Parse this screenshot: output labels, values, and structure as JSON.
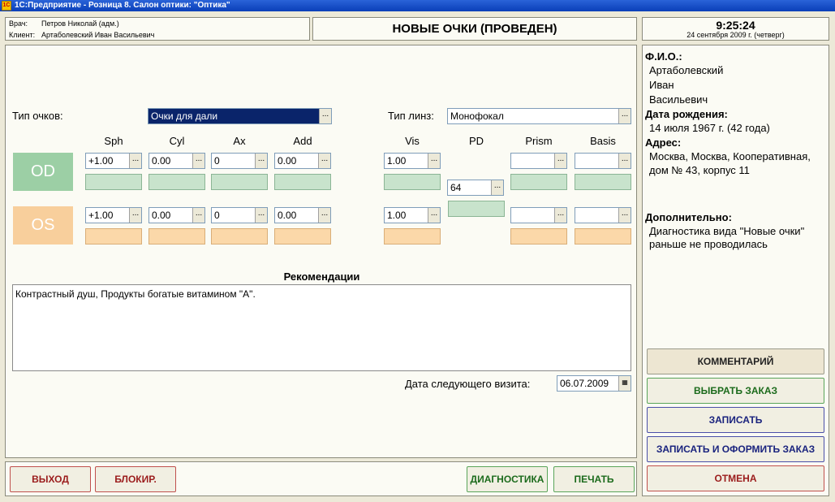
{
  "window": {
    "title": "1С:Предприятие - Розница 8. Салон оптики: \"Оптика\"",
    "icon_text": "1C"
  },
  "header": {
    "doctor_label": "Врач:",
    "doctor_value": "Петров Николай (адм.)",
    "client_label": "Клиент:",
    "client_value": "Артаболевский Иван Васильевич",
    "doc_title": "НОВЫЕ ОЧКИ (ПРОВЕДЕН)",
    "time": "9:25:24",
    "date": "24 сентября 2009 г. (четверг)"
  },
  "form": {
    "glasses_type_label": "Тип очков:",
    "glasses_type_value": "Очки для дали",
    "lens_type_label": "Тип линз:",
    "lens_type_value": "Монофокал",
    "columns": {
      "sph": "Sph",
      "cyl": "Cyl",
      "ax": "Ax",
      "add": "Add",
      "vis": "Vis",
      "pd": "PD",
      "prism": "Prism",
      "basis": "Basis"
    },
    "od": {
      "label": "OD",
      "sph": "+1.00",
      "cyl": "0.00",
      "ax": "0",
      "add": "0.00",
      "vis": "1.00",
      "prism": "",
      "basis": ""
    },
    "os": {
      "label": "OS",
      "sph": "+1.00",
      "cyl": "0.00",
      "ax": "0",
      "add": "0.00",
      "vis": "1.00",
      "prism": "",
      "basis": ""
    },
    "pd_value": "64",
    "recommendations_label": "Рекомендации",
    "recommendations_text": "Контрастный душ, Продукты богатые витамином \"А\".",
    "next_visit_label": "Дата следующего визита:",
    "next_visit_value": "06.07.2009",
    "dots": "..."
  },
  "client_card": {
    "fio_label": "Ф.И.О.:",
    "last_name": "Артаболевский",
    "first_name": "Иван",
    "patronymic": "Васильевич",
    "birth_label": "Дата рождения:",
    "birth_value": "14 июля 1967 г. (42 года)",
    "address_label": "Адрес:",
    "address_line1": "Москва, Москва, Кооперативная,",
    "address_line2": "дом № 43, корпус 11",
    "extra_label": "Дополнительно:",
    "extra_line1": "Диагностика вида \"Новые очки\"",
    "extra_line2": "раньше не проводилась"
  },
  "buttons": {
    "comment": "КОММЕНТАРИЙ",
    "choose_order": "ВЫБРАТЬ ЗАКАЗ",
    "save": "ЗАПИСАТЬ",
    "save_and_order": "ЗАПИСАТЬ И ОФОРМИТЬ ЗАКАЗ",
    "cancel": "ОТМЕНА",
    "exit": "ВЫХОД",
    "block": "БЛОКИР.",
    "diagnostics": "ДИАГНОСТИКА",
    "print": "ПЕЧАТЬ"
  },
  "colors": {
    "od": "#9ccfa5",
    "os": "#f8cf9c",
    "title_bar": "#0a3fb8",
    "selection": "#0a246a"
  }
}
